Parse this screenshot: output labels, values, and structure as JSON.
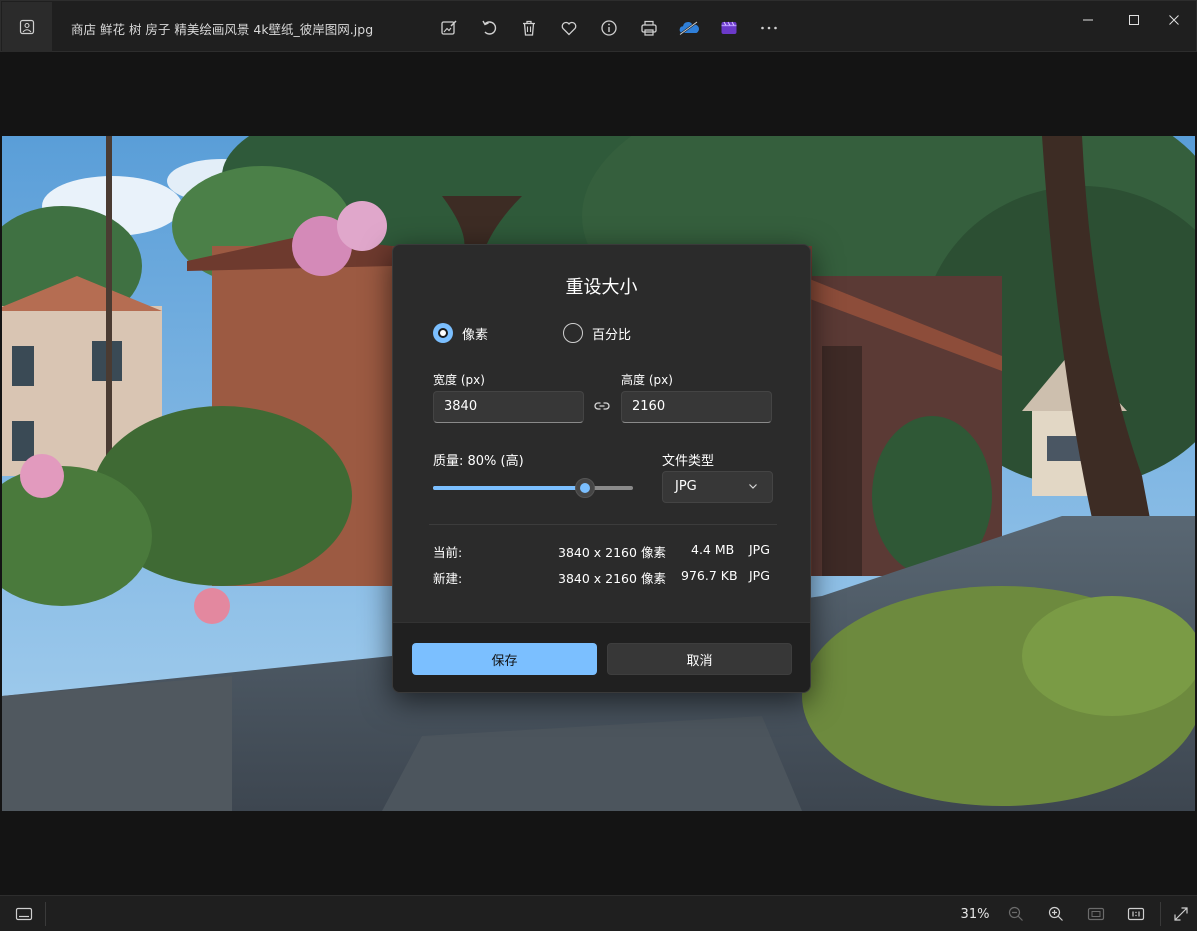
{
  "window": {
    "filename": "商店 鲜花 树 房子 精美绘画风景 4k壁纸_彼岸图网.jpg"
  },
  "toolbar": {
    "items": [
      {
        "icon": "edit-image-icon"
      },
      {
        "icon": "rotate-icon"
      },
      {
        "icon": "delete-icon"
      },
      {
        "icon": "favorite-heart-icon"
      },
      {
        "icon": "info-icon"
      },
      {
        "icon": "print-icon"
      },
      {
        "icon": "onedrive-icon"
      },
      {
        "icon": "clipchamp-icon"
      },
      {
        "icon": "more-icon"
      }
    ]
  },
  "dialog": {
    "title": "重设大小",
    "mode_pixels": "像素",
    "mode_percent": "百分比",
    "width_label": "宽度 (px)",
    "width_value": "3840",
    "height_label": "高度 (px)",
    "height_value": "2160",
    "quality_label": "质量: 80% (高)",
    "quality_percent": 80,
    "filetype_label": "文件类型",
    "filetype_value": "JPG",
    "current": {
      "label": "当前:",
      "dimensions": "3840 x 2160 像素",
      "size": "4.4 MB",
      "format": "JPG"
    },
    "new": {
      "label": "新建:",
      "dimensions": "3840 x 2160 像素",
      "size": "976.7 KB",
      "format": "JPG"
    },
    "save_label": "保存",
    "cancel_label": "取消"
  },
  "statusbar": {
    "zoom": "31%"
  },
  "colors": {
    "accent": "#7bbfff",
    "dialog_bg": "#2b2b2b",
    "titlebar_bg": "#1f1f1f"
  }
}
